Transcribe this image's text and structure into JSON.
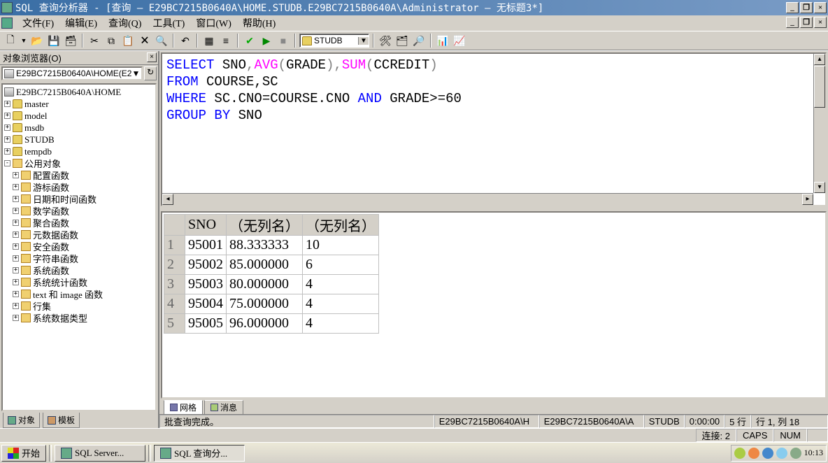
{
  "titlebar": {
    "text": "SQL 查询分析器 - [查询 — E29BC7215B0640A\\HOME.STUDB.E29BC7215B0640A\\Administrator — 无标题3*]"
  },
  "menus": {
    "file": "文件(F)",
    "edit": "编辑(E)",
    "query": "查询(Q)",
    "tools": "工具(T)",
    "window": "窗口(W)",
    "help": "帮助(H)"
  },
  "toolbar": {
    "db_combo": "STUDB"
  },
  "object_browser": {
    "title": "对象浏览器(O)",
    "server_combo": "E29BC7215B0640A\\HOME(E2",
    "root": "E29BC7215B0640A\\HOME",
    "dbs": [
      "master",
      "model",
      "msdb",
      "STUDB",
      "tempdb"
    ],
    "common_obj": "公用对象",
    "folders": [
      "配置函数",
      "游标函数",
      "日期和时间函数",
      "数学函数",
      "聚合函数",
      "元数据函数",
      "安全函数",
      "字符串函数",
      "系统函数",
      "系统统计函数",
      "text 和 image 函数",
      "行集",
      "系统数据类型"
    ],
    "tabs": {
      "objects": "对象",
      "templates": "模板"
    }
  },
  "sql": {
    "l1_select": "SELECT",
    "l1_sno": " SNO",
    "l1_c1": ",",
    "l1_avg": "AVG",
    "l1_p1": "(",
    "l1_grade": "GRADE",
    "l1_p2": ")",
    "l1_c2": ",",
    "l1_sum": "SUM",
    "l1_p3": "(",
    "l1_ccredit": "CCREDIT",
    "l1_p4": ")",
    "l2_from": "FROM",
    "l2_rest": " COURSE,SC",
    "l3_where": "WHERE",
    "l3_mid": " SC.CNO=COURSE.CNO ",
    "l3_and": "AND",
    "l3_rest": " GRADE>=60",
    "l4_group": "GROUP",
    "l4_sp": " ",
    "l4_by": "BY",
    "l4_rest": " SNO"
  },
  "results": {
    "headers": [
      "SNO",
      "（无列名）",
      "（无列名）"
    ],
    "rows": [
      [
        "95001",
        "88.333333",
        "10"
      ],
      [
        "95002",
        "85.000000",
        "6"
      ],
      [
        "95003",
        "80.000000",
        "4"
      ],
      [
        "95004",
        "75.000000",
        "4"
      ],
      [
        "95005",
        "96.000000",
        "4"
      ]
    ],
    "tabs": {
      "grid": "网格",
      "messages": "消息"
    }
  },
  "status": {
    "msg": "批查询完成。",
    "server": "E29BC7215B0640A\\H",
    "user": "E29BC7215B0640A\\A",
    "db": "STUDB",
    "time": "0:00:00",
    "rows": "5 行",
    "pos": "行 1, 列 18"
  },
  "app_status": {
    "conn": "连接: 2",
    "caps": "CAPS",
    "num": "NUM"
  },
  "taskbar": {
    "start": "开始",
    "task1": "SQL Server...",
    "task2": "SQL 查询分...",
    "clock": "10:13"
  }
}
